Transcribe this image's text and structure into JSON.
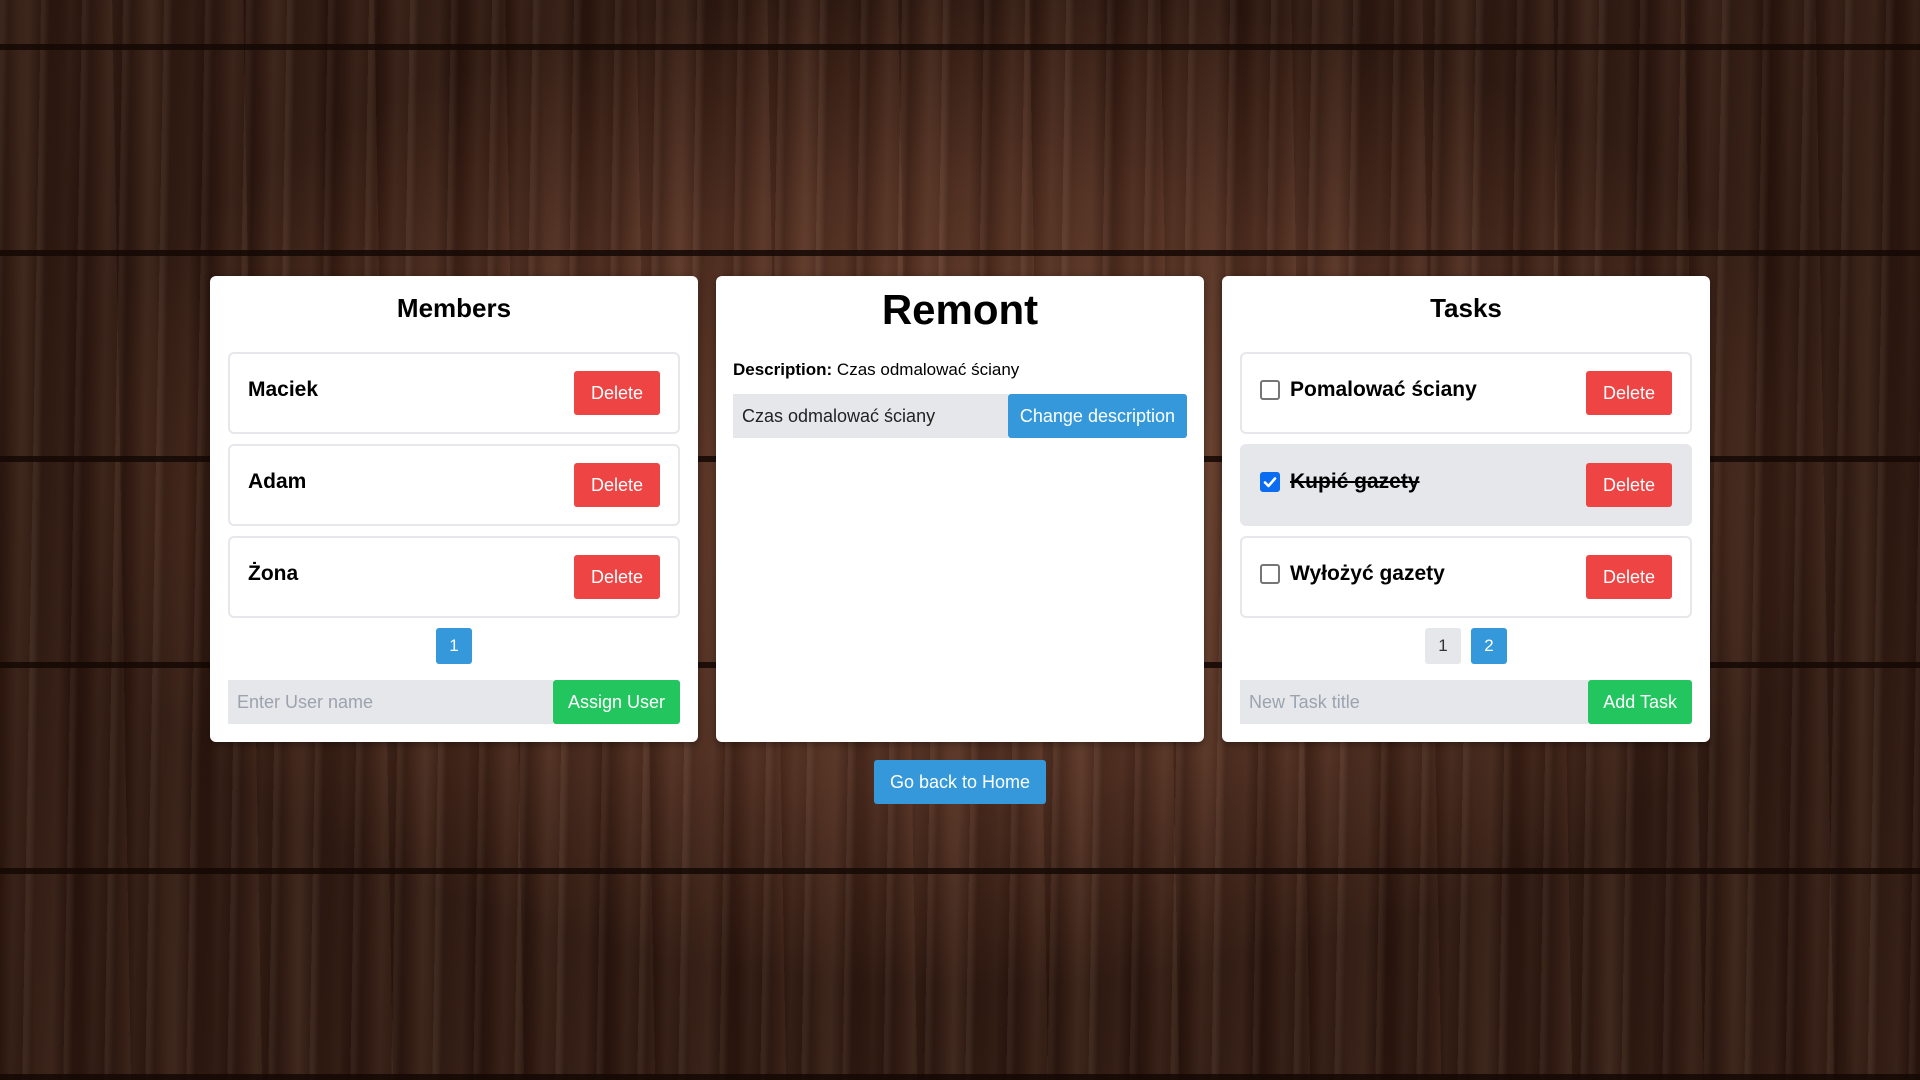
{
  "members": {
    "title": "Members",
    "items": [
      {
        "name": "Maciek",
        "delete_label": "Delete"
      },
      {
        "name": "Adam",
        "delete_label": "Delete"
      },
      {
        "name": "Żona",
        "delete_label": "Delete"
      }
    ],
    "pages": [
      "1"
    ],
    "active_page": "1",
    "input_placeholder": "Enter User name",
    "input_value": "",
    "assign_label": "Assign User"
  },
  "project": {
    "title": "Remont",
    "description_label": "Description:",
    "description_text": "Czas odmalować ściany",
    "description_input_value": "Czas odmalować ściany",
    "change_label": "Change description"
  },
  "tasks": {
    "title": "Tasks",
    "items": [
      {
        "title": "Pomalować ściany",
        "done": false,
        "delete_label": "Delete"
      },
      {
        "title": "Kupić gazety",
        "done": true,
        "delete_label": "Delete"
      },
      {
        "title": "Wyłożyć gazety",
        "done": false,
        "delete_label": "Delete"
      }
    ],
    "pages": [
      "1",
      "2"
    ],
    "active_page": "2",
    "input_placeholder": "New Task title",
    "input_value": "",
    "add_label": "Add Task"
  },
  "footer": {
    "back_label": "Go back to Home"
  },
  "colors": {
    "danger": "#ef4444",
    "success": "#22c55e",
    "primary": "#3498db",
    "muted": "#e5e7eb",
    "checkbox_checked": "#0a6cf0"
  },
  "icons": {
    "checkmark": "check-icon"
  }
}
